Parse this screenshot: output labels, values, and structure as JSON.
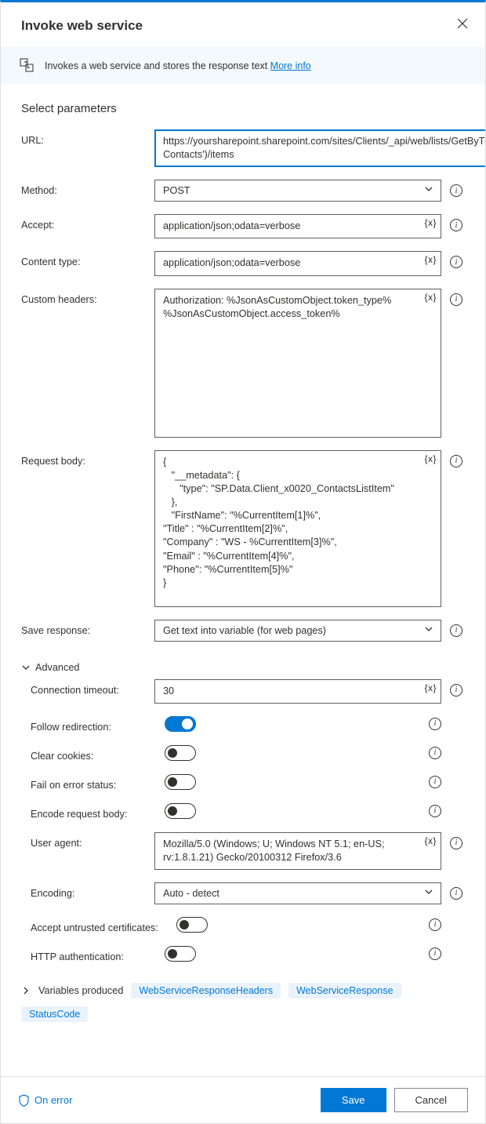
{
  "header": {
    "title": "Invoke web service"
  },
  "infoBar": {
    "text": "Invokes a web service and stores the response text ",
    "link": "More info"
  },
  "sectionTitle": "Select parameters",
  "fields": {
    "url": {
      "label": "URL:",
      "value": "https://yoursharepoint.sharepoint.com/sites/Clients/_api/web/lists/GetByTitle('Client Contacts')/items"
    },
    "method": {
      "label": "Method:",
      "value": "POST"
    },
    "accept": {
      "label": "Accept:",
      "value": "application/json;odata=verbose"
    },
    "contentType": {
      "label": "Content type:",
      "value": "application/json;odata=verbose"
    },
    "customHeaders": {
      "label": "Custom headers:",
      "value": "Authorization: %JsonAsCustomObject.token_type% %JsonAsCustomObject.access_token%"
    },
    "requestBody": {
      "label": "Request body:",
      "value": "{\n   \"__metadata\": {\n      \"type\": \"SP.Data.Client_x0020_ContactsListItem\"\n   },\n   \"FirstName\": \"%CurrentItem[1]%\",\n\"Title\" : \"%CurrentItem[2]%\",\n\"Company\" : \"WS - %CurrentItem[3]%\",\n\"Email\" : \"%CurrentItem[4]%\",\n\"Phone\": \"%CurrentItem[5]%\"\n}"
    },
    "saveResponse": {
      "label": "Save response:",
      "value": "Get text into variable (for web pages)"
    }
  },
  "advanced": {
    "title": "Advanced",
    "connectionTimeout": {
      "label": "Connection timeout:",
      "value": "30"
    },
    "followRedirection": {
      "label": "Follow redirection:",
      "on": true
    },
    "clearCookies": {
      "label": "Clear cookies:",
      "on": false
    },
    "failOnError": {
      "label": "Fail on error status:",
      "on": false
    },
    "encodeBody": {
      "label": "Encode request body:",
      "on": false
    },
    "userAgent": {
      "label": "User agent:",
      "value": "Mozilla/5.0 (Windows; U; Windows NT 5.1; en-US; rv:1.8.1.21) Gecko/20100312 Firefox/3.6"
    },
    "encoding": {
      "label": "Encoding:",
      "value": "Auto - detect"
    },
    "acceptUntrusted": {
      "label": "Accept untrusted certificates:",
      "on": false
    },
    "httpAuth": {
      "label": "HTTP authentication:",
      "on": false
    }
  },
  "varsProduced": {
    "title": "Variables produced",
    "items": [
      "WebServiceResponseHeaders",
      "WebServiceResponse",
      "StatusCode"
    ]
  },
  "footer": {
    "onError": "On error",
    "save": "Save",
    "cancel": "Cancel"
  },
  "tokens": {
    "var": "{x}"
  }
}
